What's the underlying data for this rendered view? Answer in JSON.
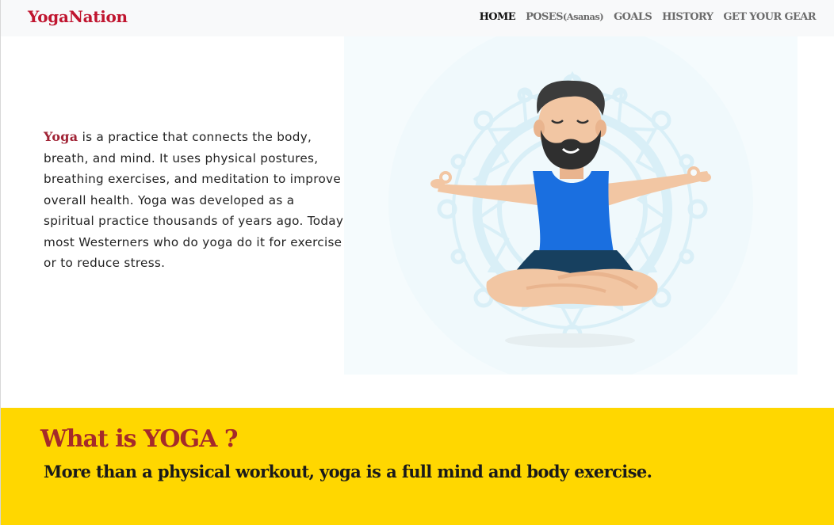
{
  "navbar": {
    "brand": "YogaNation",
    "links": {
      "home": "HOME",
      "poses": "POSES",
      "poses_sub": "(Asanas)",
      "goals": "GOALS",
      "history": "HISTORY",
      "gear": "GET YOUR GEAR"
    }
  },
  "intro": {
    "keyword": "Yoga",
    "text": " is a practice that connects the body, breath, and mind. It uses physical postures, breathing exercises, and meditation to improve overall health. Yoga was developed as a spiritual practice thousands of years ago. Today, most Westerners who do yoga do it for exercise or to reduce stress."
  },
  "illustration": {
    "icon": "meditating-man-illustration"
  },
  "section": {
    "title": "What is YOGA ?",
    "subtitle": "More than a physical workout, yoga is a full mind and body exercise."
  },
  "colors": {
    "brand": "#c0152f",
    "band": "#ffd700",
    "title": "#a52a2a"
  }
}
